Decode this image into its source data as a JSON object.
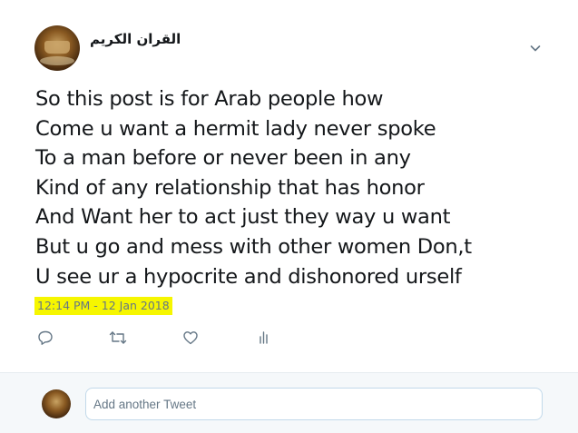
{
  "tweet": {
    "author_name": "القران الكريم",
    "text_lines": [
      "So this post is for Arab people how",
      "Come u want a hermit lady never spoke",
      "To a man before or never been in any",
      "Kind of any relationship that has honor",
      "And Want her to act just they way u want",
      "But u go and mess with other women Don,t",
      "U see ur a hypocrite and dishonored urself"
    ],
    "timestamp": "12:14 PM - 12 Jan 2018",
    "highlight_color": "#f6f600"
  },
  "actions": {
    "reply_icon": "reply-icon",
    "retweet_icon": "retweet-icon",
    "like_icon": "heart-icon",
    "analytics_icon": "analytics-icon",
    "icon_color": "#657786"
  },
  "reply_box": {
    "placeholder": "Add another Tweet"
  }
}
